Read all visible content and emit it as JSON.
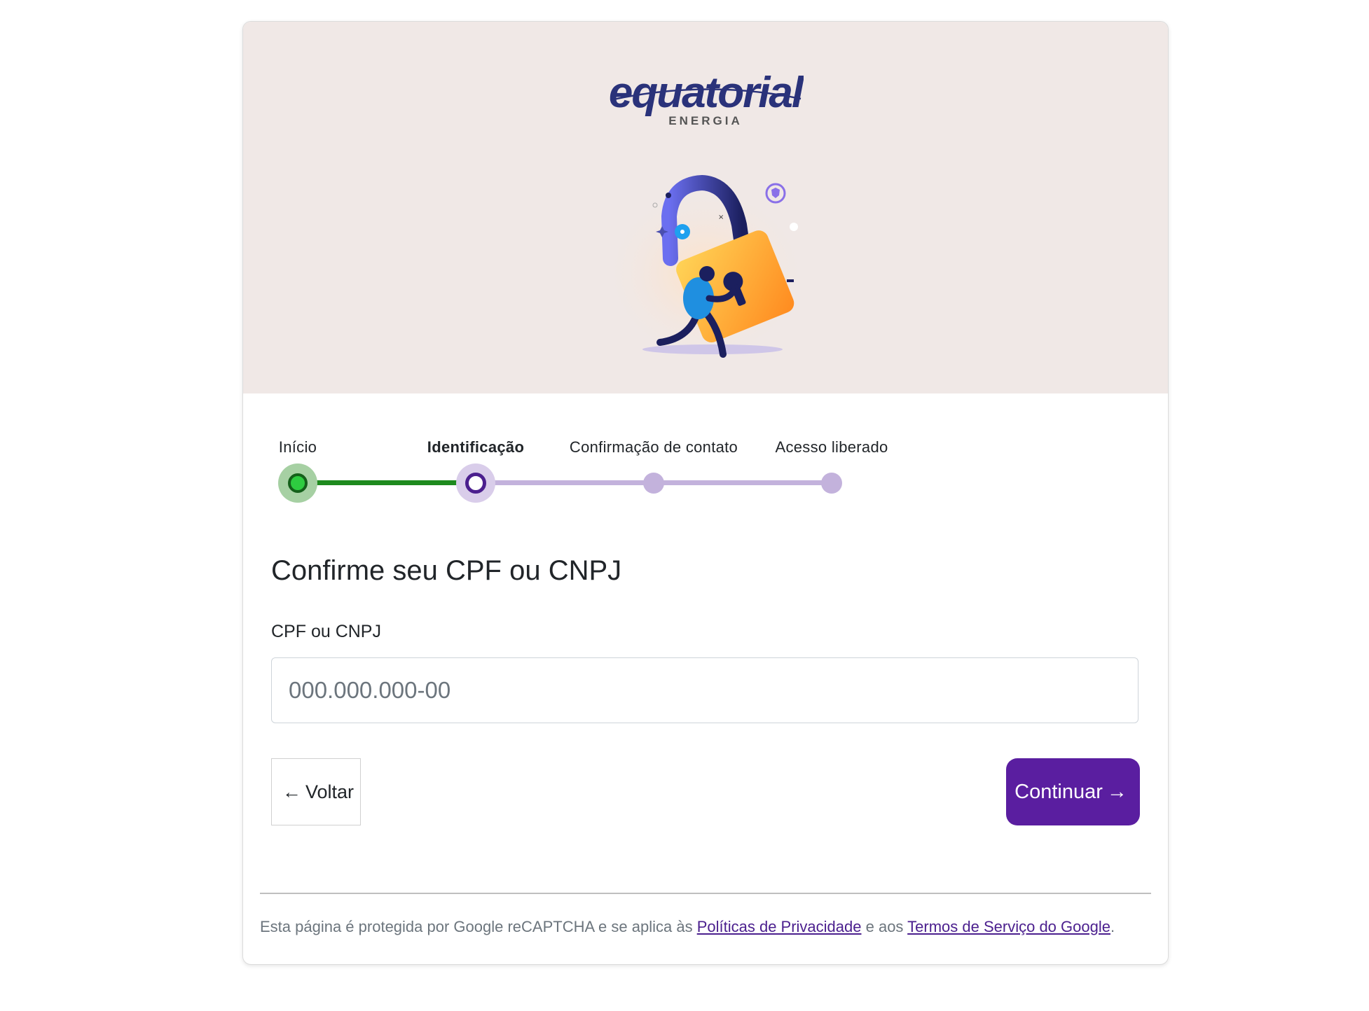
{
  "brand": {
    "logo_text": "equatorial",
    "logo_subtext": "ENERGIA",
    "color": "#2a327a"
  },
  "stepper": {
    "steps": [
      {
        "label": "Início",
        "state": "done"
      },
      {
        "label": "Identificação",
        "state": "active"
      },
      {
        "label": "Confirmação de contato",
        "state": "todo"
      },
      {
        "label": "Acesso liberado",
        "state": "todo"
      }
    ],
    "colors": {
      "done": "#1e8a1e",
      "active": "#4b1f8e",
      "todo": "#c3b2dc"
    }
  },
  "form": {
    "title": "Confirme seu CPF ou CNPJ",
    "field_label": "CPF ou CNPJ",
    "field_value": "",
    "field_placeholder": "000.000.000-00"
  },
  "actions": {
    "back_label": "Voltar",
    "back_icon": "arrow-left-icon",
    "continue_label": "Continuar",
    "continue_icon": "arrow-right-icon",
    "continue_color": "#5a1ea0"
  },
  "footer": {
    "text_before": "Esta página é protegida por Google reCAPTCHA e se aplica às ",
    "privacy_link": "Políticas de Privacidade",
    "text_middle": " e aos ",
    "terms_link": "Termos de Serviço do Google",
    "text_after": "."
  }
}
